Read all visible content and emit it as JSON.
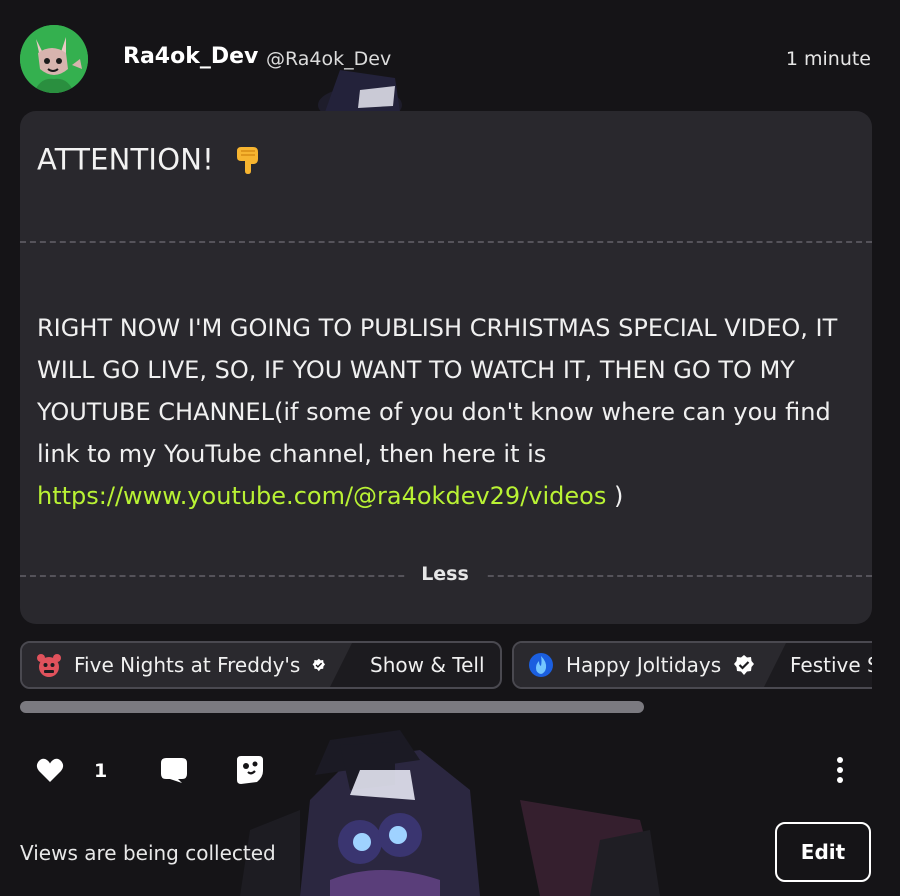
{
  "post": {
    "author_name": "Ra4ok_Dev",
    "author_handle": "@Ra4ok_Dev",
    "timestamp": "1 minute"
  },
  "content": {
    "heading": "ATTENTION!",
    "heading_emoji": "backhand-index-pointing-down",
    "body_text": "RIGHT NOW I'M GOING TO PUBLISH CRHISTMAS SPECIAL VIDEO, IT WILL GO LIVE, SO, IF YOU WANT TO WATCH IT, THEN GO TO MY YOUTUBE CHANNEL(if some of you don't know where can you find link to my YouTube channel, then here it is ",
    "link_text": "https://www.youtube.com/@ra4okdev29/videos",
    "body_suffix": " )",
    "less_label": "Less"
  },
  "tags": [
    {
      "community": "Five Nights at Freddy's",
      "topic": "Show & Tell",
      "icon": "freddy-icon"
    },
    {
      "community": "Happy Joltidays",
      "topic": "Festive S",
      "icon": "blue-flame-icon"
    }
  ],
  "actions": {
    "like_count": "1",
    "like_icon": "heart-icon",
    "comment_icon": "comment-icon",
    "share_icon": "share-icon",
    "more_icon": "more-vertical-icon"
  },
  "footer": {
    "views_text": "Views are being collected",
    "edit_label": "Edit"
  },
  "colors": {
    "background": "#151417",
    "card": "#29282d",
    "link": "#b9f234",
    "verified": "#ffffff"
  }
}
